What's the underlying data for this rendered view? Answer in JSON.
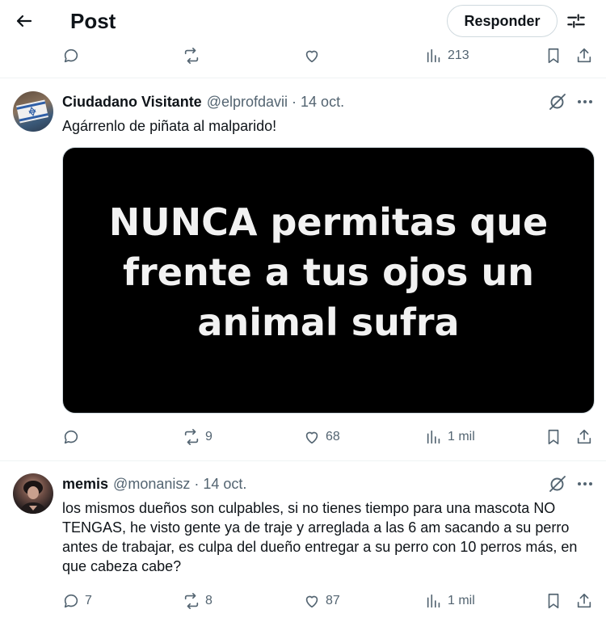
{
  "header": {
    "title": "Post",
    "reply_label": "Responder",
    "back_icon": "arrow-left-icon",
    "settings_icon": "sliders-icon"
  },
  "prev_tweet_actions": {
    "views": "213"
  },
  "tweets": [
    {
      "author_name": "Ciudadano Visitante",
      "handle": "@elprofdavii",
      "separator": "·",
      "date": "14 oct.",
      "text": "Agárrenlo de piñata al malparido!",
      "media_text": "NUNCA permitas que frente a tus ojos un animal sufra",
      "replies": "",
      "reposts": "9",
      "likes": "68",
      "views": "1 mil"
    },
    {
      "author_name": "memis",
      "handle": "@monanisz",
      "separator": "·",
      "date": "14 oct.",
      "text": "los mismos dueños son culpables, si no tienes tiempo para una mascota NO TENGAS, he visto gente ya de traje y arreglada a las 6 am sacando a su perro antes de trabajar, es culpa del dueño entregar a su perro con 10 perros más, en que cabeza cabe?",
      "replies": "7",
      "reposts": "8",
      "likes": "87",
      "views": "1 mil"
    }
  ],
  "colors": {
    "text": "#0f1419",
    "secondary": "#536471",
    "border": "#cfd9de",
    "divider": "#eff3f4"
  }
}
